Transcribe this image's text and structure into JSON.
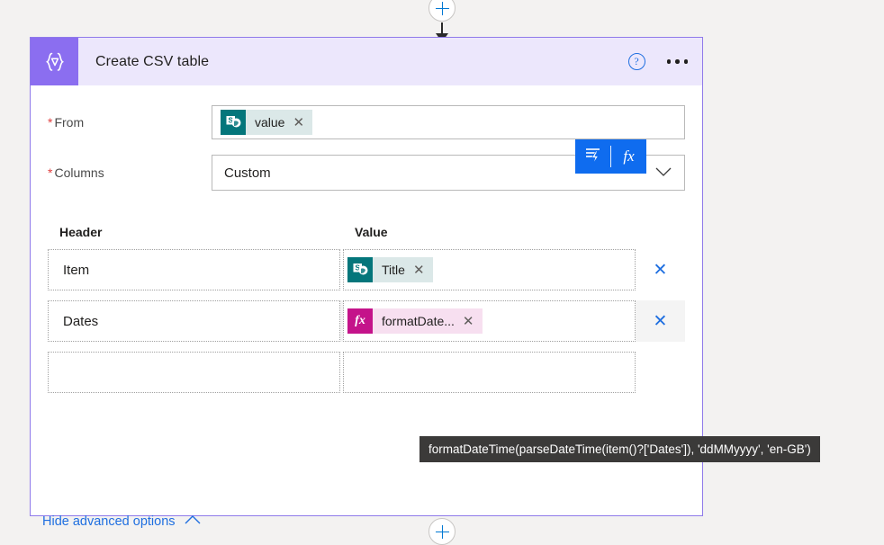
{
  "connectors": {
    "top": {
      "icon": "plus-icon",
      "arrow": "arrow-down-icon"
    },
    "bottom": {
      "icon": "plus-icon"
    }
  },
  "card": {
    "icon": "compose-expression-icon",
    "title": "Create CSV table",
    "help_label": "?",
    "more_label": "more-options",
    "fields": {
      "from": {
        "label": "From",
        "required_marker": "*",
        "token": {
          "icon": "sharepoint-icon",
          "label": "value",
          "remove": "✕"
        }
      },
      "columns": {
        "label": "Columns",
        "required_marker": "*",
        "value": "Custom",
        "chevron": "∨"
      }
    },
    "table": {
      "columns": [
        "Header",
        "Value"
      ],
      "rows": [
        {
          "key": "Item",
          "value_token": {
            "icon": "sharepoint-icon",
            "label": "Title",
            "remove": "✕"
          },
          "delete": "✕"
        },
        {
          "key": "Dates",
          "value_token": {
            "icon": "fx-icon",
            "label": "formatDate...",
            "remove": "✕"
          },
          "delete": "✕"
        },
        {
          "key": "",
          "value_token": null,
          "delete": ""
        }
      ]
    },
    "expression_toolbar": {
      "dynamic_content_label": "dynamic-content",
      "fx_label": "fx"
    },
    "tooltip": "formatDateTime(parseDateTime(item()?['Dates']), 'ddMMyyyy', 'en-GB')",
    "advanced_options": {
      "label": "Hide advanced options",
      "chevron": "∧"
    }
  },
  "colors": {
    "card_border": "#8f7aea",
    "header_bg": "#ece7fc",
    "icon_bg": "#8b6ef0",
    "accent_blue": "#0f6cef",
    "sharepoint_teal": "#04767b",
    "fx_magenta": "#c4138a",
    "required_red": "#e03e3e",
    "tooltip_bg": "#3b3a39"
  }
}
